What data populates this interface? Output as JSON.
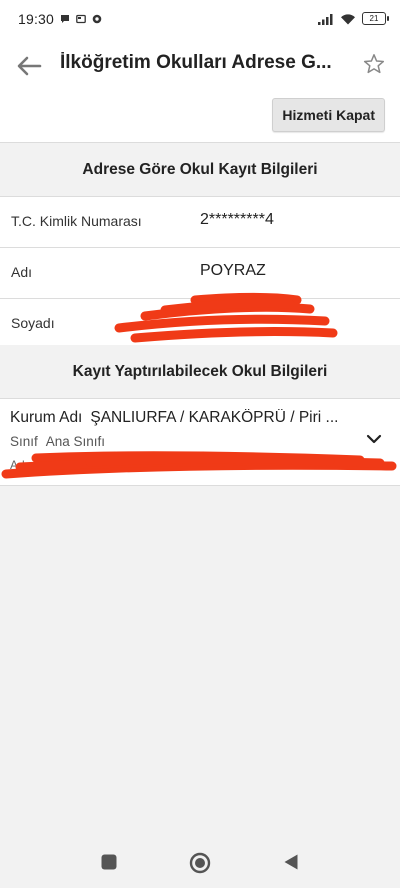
{
  "status_bar": {
    "time": "19:30",
    "battery": "21",
    "icons": [
      "message-icon",
      "screen-icon",
      "chrome-icon",
      "signal-icon",
      "wifi-icon",
      "battery-icon"
    ]
  },
  "app_bar": {
    "title": "İlköğretim Okulları Adrese G...",
    "back_icon": "arrow-left-icon",
    "favorite_icon": "star-outline-icon"
  },
  "actions": {
    "close_service_label": "Hizmeti Kapat"
  },
  "registration_section": {
    "title": "Adrese Göre Okul Kayıt Bilgileri",
    "rows": [
      {
        "label": "T.C. Kimlik Numarası",
        "value": "2*********4"
      },
      {
        "label": "Adı",
        "value": "POYRAZ"
      },
      {
        "label": "Soyadı",
        "value": ""
      }
    ]
  },
  "school_section": {
    "title": "Kayıt Yaptırılabilecek Okul Bilgileri",
    "card": {
      "kurum_label": "Kurum Adı",
      "kurum_value": "ŞANLIURFA / KARAKÖPRÜ / Piri ...",
      "sinif_label": "Sınıf",
      "sinif_value": "Ana Sınıfı",
      "adres_label": "Adre"
    }
  },
  "colors": {
    "redaction": "#f03a17",
    "background": "#f2f2f2",
    "card": "#ffffff"
  }
}
